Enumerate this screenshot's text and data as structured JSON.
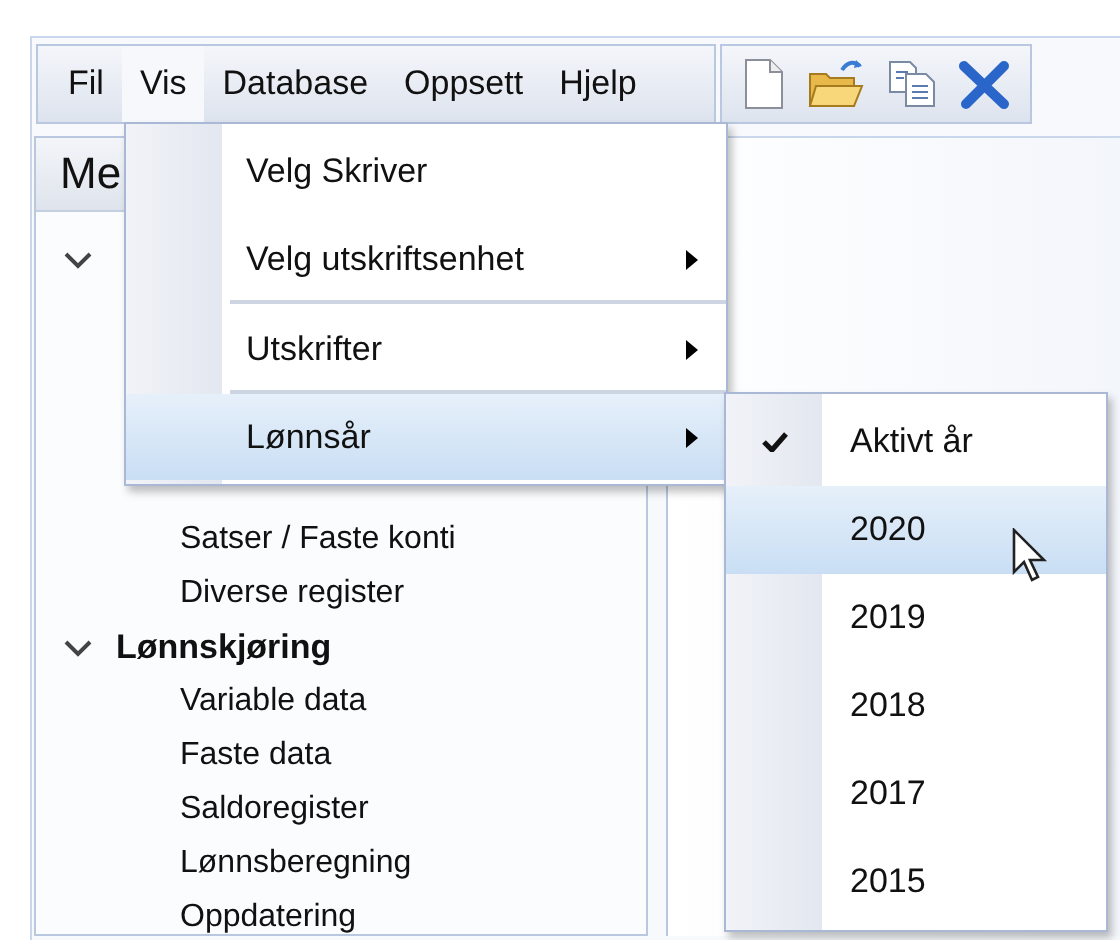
{
  "menubar": [
    {
      "label": "Fil",
      "selected": false
    },
    {
      "label": "Vis",
      "selected": true
    },
    {
      "label": "Database",
      "selected": false
    },
    {
      "label": "Oppsett",
      "selected": false
    },
    {
      "label": "Hjelp",
      "selected": false
    }
  ],
  "toolbar": [
    {
      "kind": "new"
    },
    {
      "kind": "open"
    },
    {
      "kind": "copy"
    },
    {
      "kind": "delete"
    }
  ],
  "panel": {
    "title": "Me"
  },
  "tree": [
    {
      "expanded": true,
      "children": [
        {
          "label": "Satser / Faste konti"
        },
        {
          "label": "Diverse register"
        }
      ]
    },
    {
      "label": "Lønnskjøring",
      "expanded": true,
      "children": [
        {
          "label": "Variable data"
        },
        {
          "label": "Faste data"
        },
        {
          "label": "Saldoregister"
        },
        {
          "label": "Lønnsberegning"
        },
        {
          "label": "Oppdatering"
        }
      ]
    }
  ],
  "menu": {
    "items": [
      {
        "label": "Velg Skriver",
        "submenu": false,
        "selected": false,
        "separator_after": false
      },
      {
        "label": "Velg utskriftsenhet",
        "submenu": true,
        "selected": false,
        "separator_after": true
      },
      {
        "label": "Utskrifter",
        "submenu": true,
        "selected": false,
        "separator_after": true
      },
      {
        "label": "Lønnsår",
        "submenu": true,
        "selected": true,
        "separator_after": false
      }
    ]
  },
  "submenu": {
    "items": [
      {
        "label": "Aktivt år",
        "checked": true,
        "selected": false
      },
      {
        "label": "2020",
        "checked": false,
        "selected": true
      },
      {
        "label": "2019",
        "checked": false,
        "selected": false
      },
      {
        "label": "2018",
        "checked": false,
        "selected": false
      },
      {
        "label": "2017",
        "checked": false,
        "selected": false
      },
      {
        "label": "2015",
        "checked": false,
        "selected": false
      }
    ]
  }
}
